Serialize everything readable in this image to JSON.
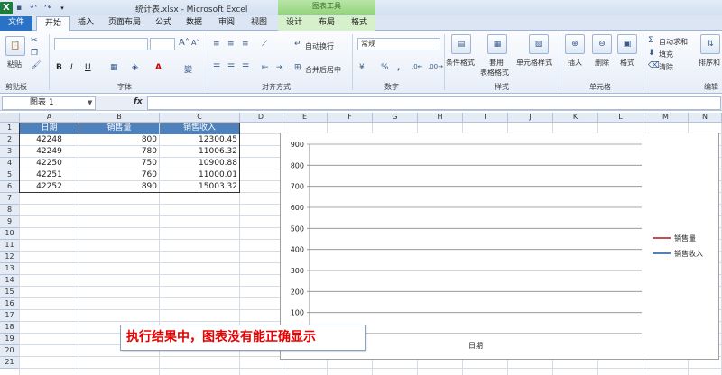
{
  "window": {
    "title": "统计表.xlsx - Microsoft Excel",
    "context_group": "图表工具"
  },
  "tabs": [
    {
      "label": "文件"
    },
    {
      "label": "开始"
    },
    {
      "label": "插入"
    },
    {
      "label": "页面布局"
    },
    {
      "label": "公式"
    },
    {
      "label": "数据"
    },
    {
      "label": "审阅"
    },
    {
      "label": "视图"
    },
    {
      "label": "设计"
    },
    {
      "label": "布局"
    },
    {
      "label": "格式"
    }
  ],
  "ribbon": {
    "clipboard": {
      "paste": "粘贴",
      "label": "剪贴板"
    },
    "font": {
      "label": "字体",
      "bold": "B",
      "italic": "I",
      "underline": "U",
      "grow": "A",
      "shrink": "A",
      "font_color": "A"
    },
    "alignment": {
      "label": "对齐方式",
      "wrap": "自动换行",
      "merge": "合并后居中"
    },
    "number": {
      "label": "数字",
      "format": "常规",
      "percent": "%",
      "comma": ","
    },
    "styles": {
      "label": "样式",
      "conditional": "条件格式",
      "table_format": "套用\n表格格式",
      "table_format_l1": "套用",
      "table_format_l2": "表格格式",
      "cell_styles": "单元格样式"
    },
    "cells": {
      "label": "单元格",
      "insert": "插入",
      "delete": "删除",
      "format": "格式"
    },
    "editing": {
      "label": "编辑",
      "autosum": "自动求和",
      "fill": "填充",
      "clear": "清除",
      "sort": "排序和"
    }
  },
  "formula_bar": {
    "name_box": "图表 1",
    "fx": "fx"
  },
  "columns": [
    "A",
    "B",
    "C",
    "D",
    "E",
    "F",
    "G",
    "H",
    "I",
    "J",
    "K",
    "L",
    "M",
    "N"
  ],
  "rows": [
    "1",
    "2",
    "3",
    "4",
    "5",
    "6",
    "7",
    "8",
    "9",
    "10",
    "11",
    "12",
    "13",
    "14",
    "15",
    "16",
    "17",
    "18",
    "19",
    "20",
    "21"
  ],
  "table": {
    "headers": [
      "日期",
      "销售量",
      "销售收入"
    ],
    "rows": [
      [
        "42248",
        "800",
        "12300.45"
      ],
      [
        "42249",
        "780",
        "11006.32"
      ],
      [
        "42250",
        "750",
        "10900.88"
      ],
      [
        "42251",
        "760",
        "11000.01"
      ],
      [
        "42252",
        "890",
        "15003.32"
      ]
    ]
  },
  "chart_data": {
    "type": "line",
    "categories": [],
    "series": [
      {
        "name": "销售量",
        "values": [],
        "color": "#c0504d"
      },
      {
        "name": "销售收入",
        "values": [],
        "color": "#4f81bd"
      }
    ],
    "ylim": [
      0,
      900
    ],
    "yticks": [
      "100",
      "200",
      "300",
      "400",
      "500",
      "600",
      "700",
      "800",
      "900"
    ],
    "xlabel": "日期",
    "grid": true,
    "legend": "right"
  },
  "annotation": "执行结果中，图表没有能正确显示"
}
